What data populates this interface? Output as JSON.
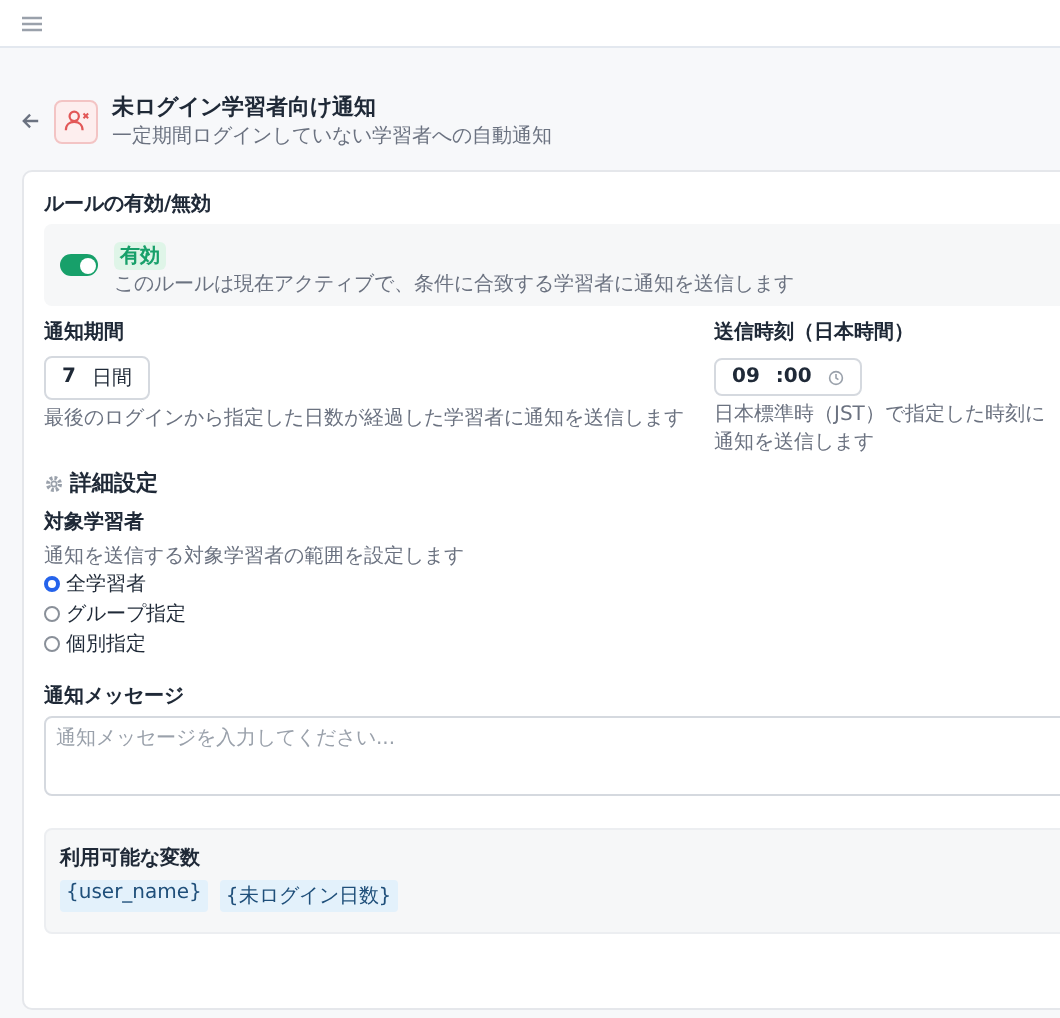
{
  "header": {
    "title": "未ログイン学習者向け通知",
    "subtitle": "一定期間ログインしていない学習者への自動通知"
  },
  "rule": {
    "heading": "ルールの有効/無効",
    "on": true,
    "badge": "有効",
    "description": "このルールは現在アクティブで、条件に合致する学習者に通知を送信します"
  },
  "period": {
    "label": "通知期間",
    "value": "7",
    "unit": "日間",
    "help": "最後のログインから指定した日数が経過した学習者に通知を送信します"
  },
  "time": {
    "label": "送信時刻（日本時間）",
    "hour": "09",
    "separator": ":",
    "minute": "00",
    "help": "日本標準時（JST）で指定した時刻に通知を送信します"
  },
  "advanced": {
    "heading": "詳細設定"
  },
  "target": {
    "label": "対象学習者",
    "help": "通知を送信する対象学習者の範囲を設定します",
    "options": [
      {
        "label": "全学習者",
        "selected": true
      },
      {
        "label": "グループ指定",
        "selected": false
      },
      {
        "label": "個別指定",
        "selected": false
      }
    ]
  },
  "message": {
    "label": "通知メッセージ",
    "placeholder": "通知メッセージを入力してください..."
  },
  "variables": {
    "heading": "利用可能な変数",
    "items": [
      "{user_name}",
      "{未ログイン日数}"
    ]
  }
}
